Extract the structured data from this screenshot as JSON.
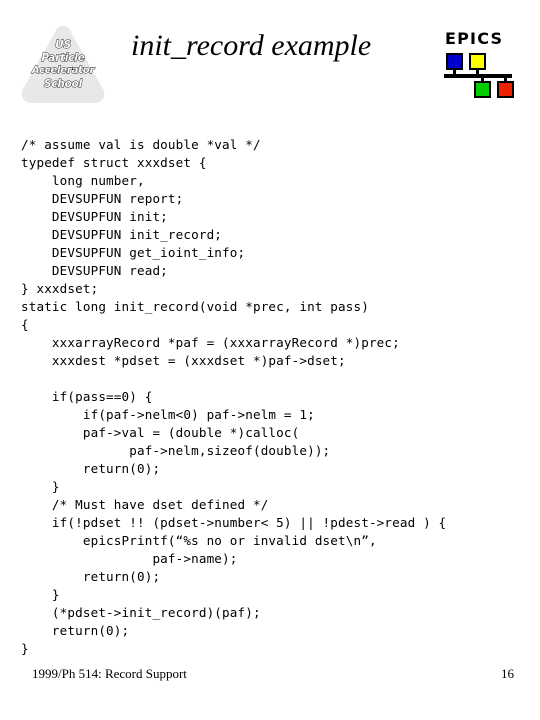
{
  "slide": {
    "title": "init_record example",
    "background_color": "#ffffff"
  },
  "uspas_logo": {
    "name": "us-particle-accelerator-school-logo",
    "lines": [
      "US",
      "Particle",
      "Accelerator",
      "School"
    ],
    "shape_color": "#e8e8e8",
    "text_fill": "#ffffff",
    "text_outline": "#1a1a1a"
  },
  "epics_logo": {
    "word": "EPICS",
    "nodes": [
      {
        "name": "node-blue",
        "color": "#0000cc"
      },
      {
        "name": "node-yellow",
        "color": "#ffff00"
      },
      {
        "name": "node-green",
        "color": "#00cc00"
      },
      {
        "name": "node-red",
        "color": "#ee2200"
      }
    ],
    "bus_color": "#000000"
  },
  "code": {
    "language": "c",
    "lines": [
      "/* assume val is double *val */",
      "typedef struct xxxdset {",
      "    long number,",
      "    DEVSUPFUN report;",
      "    DEVSUPFUN init;",
      "    DEVSUPFUN init_record;",
      "    DEVSUPFUN get_ioint_info;",
      "    DEVSUPFUN read;",
      "} xxxdset;",
      "static long init_record(void *prec, int pass)",
      "{",
      "    xxxarrayRecord *paf = (xxxarrayRecord *)prec;",
      "    xxxdest *pdset = (xxxdset *)paf->dset;",
      "",
      "    if(pass==0) {",
      "        if(paf->nelm<0) paf->nelm = 1;",
      "        paf->val = (double *)calloc(",
      "              paf->nelm,sizeof(double));",
      "        return(0);",
      "    }",
      "    /* Must have dset defined */",
      "    if(!pdset !! (pdset->number< 5) || !pdest->read ) {",
      "        epicsPrintf(“%s no or invalid dset\\n”,",
      "                 paf->name);",
      "        return(0);",
      "    }",
      "    (*pdset->init_record)(paf);",
      "    return(0);",
      "}"
    ]
  },
  "footer": {
    "course": "1999/Ph 514: Record Support",
    "page_number": "16"
  }
}
